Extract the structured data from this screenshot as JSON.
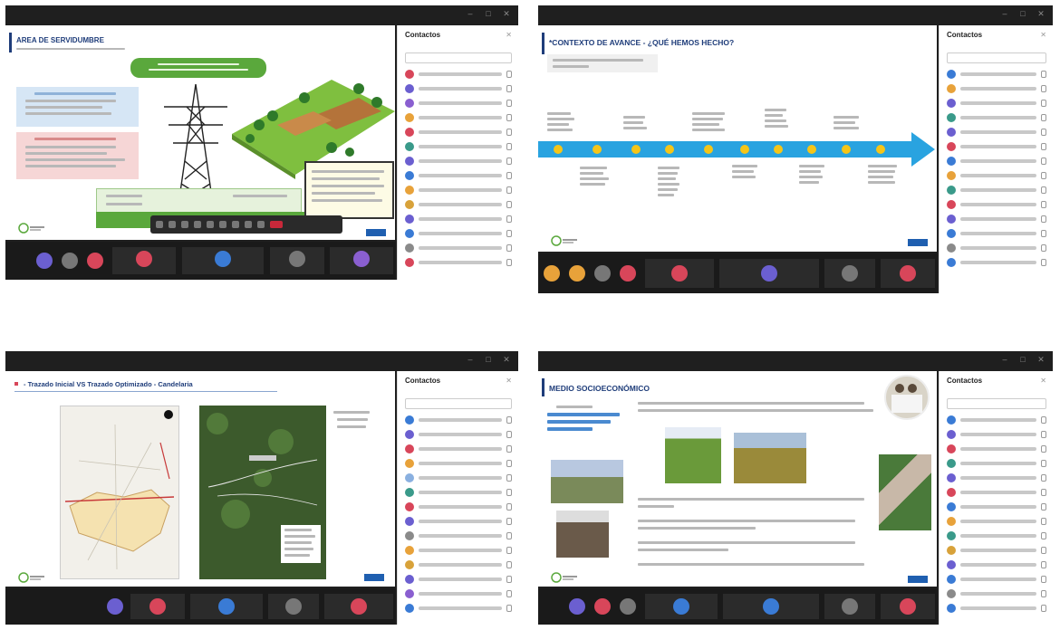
{
  "windows": [
    {
      "id": "w1",
      "slide_title": "AREA DE SERVIDUMBRE",
      "panel_title": "Contactos",
      "participants": 14
    },
    {
      "id": "w2",
      "slide_title": "*CONTEXTO DE AVANCE - ¿QUÉ HEMOS HECHO?",
      "panel_title": "Contactos",
      "participants": 14
    },
    {
      "id": "w3",
      "slide_title": "- Trazado Inicial VS Trazado Optimizado - Candelaria",
      "panel_title": "Contactos",
      "participants": 14
    },
    {
      "id": "w4",
      "slide_title": "MEDIO SOCIOECONÓMICO",
      "panel_title": "Contactos",
      "participants": 14
    }
  ],
  "colors": {
    "navy": "#1f3d7a",
    "accent_blue": "#29a3e0",
    "green": "#5aa83c",
    "end_call_red": "#c8283a",
    "avatar_purple": "#6b5fd0",
    "avatar_red": "#d8465a",
    "avatar_gray": "#777777",
    "avatar_orange": "#e8a23a"
  },
  "icons": [
    "minimize-icon",
    "maximize-icon",
    "close-icon",
    "end-call-icon",
    "camera-icon",
    "microphone-icon",
    "share-screen-icon",
    "avatar-icon"
  ]
}
